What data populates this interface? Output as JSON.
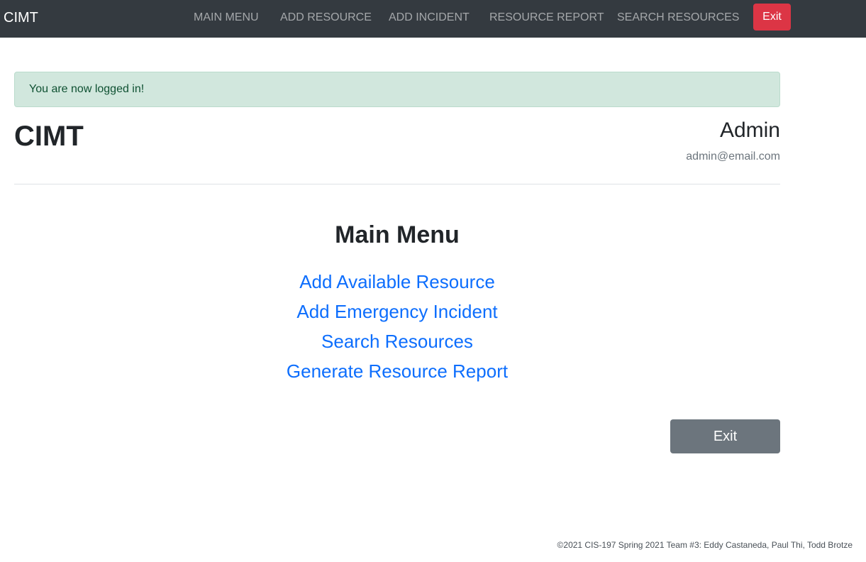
{
  "navbar": {
    "brand": "CIMT",
    "links": [
      "MAIN MENU",
      "ADD RESOURCE",
      "ADD INCIDENT",
      "RESOURCE REPORT",
      "SEARCH RESOURCES"
    ],
    "exit_label": "Exit"
  },
  "alert": {
    "message": "You are now logged in!"
  },
  "header": {
    "title": "CIMT",
    "user_name": "Admin",
    "user_email": "admin@email.com"
  },
  "main_menu": {
    "heading": "Main Menu",
    "links": [
      "Add Available Resource",
      "Add Emergency Incident",
      "Search Resources",
      "Generate Resource Report"
    ]
  },
  "exit_button": "Exit",
  "footer": "©2021 CIS-197 Spring 2021 Team #3: Eddy Castaneda, Paul Thi, Todd Brotze",
  "colors": {
    "navbar_bg": "#343a40",
    "danger": "#dc3545",
    "link": "#0d6efd",
    "success_bg": "#d1e7dd",
    "secondary": "#6c757d"
  }
}
